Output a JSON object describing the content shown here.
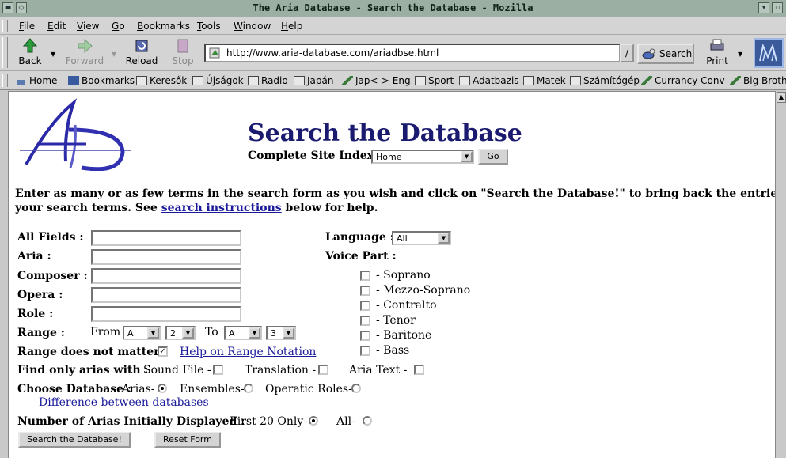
{
  "window": {
    "title": "The Aria Database - Search the Database - Mozilla"
  },
  "menu": [
    "File",
    "Edit",
    "View",
    "Go",
    "Bookmarks",
    "Tools",
    "Window",
    "Help"
  ],
  "toolbar": {
    "back": "Back",
    "forward": "Forward",
    "reload": "Reload",
    "stop": "Stop",
    "url": "http://www.aria-database.com/ariadbse.html",
    "url_slash": "/",
    "search": "Search",
    "print": "Print"
  },
  "personal": [
    "Home",
    "Bookmarks",
    "Keresők",
    "Újságok",
    "Radio",
    "Japán",
    "Jap<-> Eng",
    "Sport",
    "Adatbazis",
    "Matek",
    "Számítógép",
    "Currancy Conv",
    "Big Broth"
  ],
  "page": {
    "heading": "Search the Database",
    "site_index_label": "Complete Site Index :",
    "site_index_value": "Home",
    "go": "Go",
    "intro_1": "Enter as many or as few terms in the search form as you wish and click on \"Search the Database!\" to bring back the entries matching",
    "intro_2a": "your search terms. See ",
    "intro_link": "search instructions",
    "intro_2b": " below for help."
  },
  "form": {
    "fields": {
      "all": "All Fields :",
      "aria": "Aria :",
      "composer": "Composer :",
      "opera": "Opera :",
      "role": "Role :"
    },
    "range_label": "Range :",
    "from": "From",
    "to": "To",
    "from_note": "A",
    "from_oct": "2",
    "to_note": "A",
    "to_oct": "3",
    "range_nm": "Range does not matter -",
    "range_nm_checked": true,
    "range_help": "Help on Range Notation",
    "language_label": "Language :",
    "language_value": "All",
    "voice_label": "Voice Part :",
    "voices": [
      "- Soprano",
      "- Mezzo-Soprano",
      "- Contralto",
      "- Tenor",
      "- Baritone",
      "- Bass"
    ],
    "find_label": "Find only arias with :",
    "sound": "Sound File -",
    "translation": "Translation -",
    "aria_text": "Aria Text -",
    "db_label": "Choose Database :",
    "db_arias": "Arias-",
    "db_ensembles": "Ensembles-",
    "db_roles": "Operatic Roles-",
    "db_selected": "Arias",
    "diff_link": "Difference between databases",
    "num_label": "Number of Arias Initially Displayed :",
    "first20": "First 20 Only-",
    "all": "All-",
    "num_selected": "First 20 Only",
    "submit": "Search the Database!",
    "reset": "Reset Form"
  },
  "colors": {
    "heading": "#1a1a6e",
    "link": "#1a1a9a",
    "titlebar": "#9bb0a3"
  }
}
